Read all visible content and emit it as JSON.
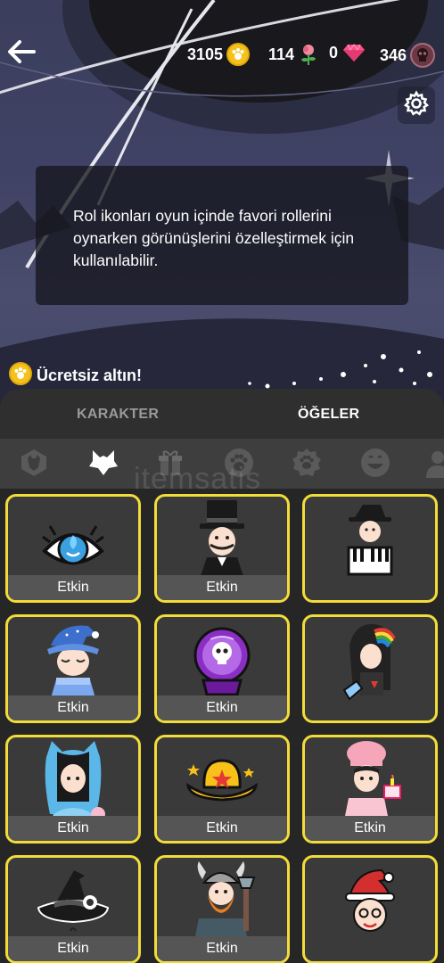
{
  "header": {
    "back_icon": "arrow-left-icon",
    "currencies": [
      {
        "value": "3105",
        "icon": "gold-coin-icon"
      },
      {
        "value": "114",
        "icon": "rose-icon"
      },
      {
        "value": "0",
        "icon": "gem-icon"
      },
      {
        "value": "346",
        "icon": "skull-token-icon"
      }
    ],
    "settings_icon": "gear-icon"
  },
  "info": {
    "text": "Rol ikonları oyun içinde favori rollerini oynarken görünüşlerini özelleştirmek için kullanılabilir."
  },
  "free_gold": {
    "label": "Ücretsiz altın!",
    "icon": "paw-coin-icon"
  },
  "tabs": [
    {
      "label": "KARAKTER",
      "active": false
    },
    {
      "label": "ÖĞELER",
      "active": true
    }
  ],
  "categories": [
    {
      "icon": "wolf-badge-icon",
      "active": false
    },
    {
      "icon": "wolf-head-icon",
      "active": true
    },
    {
      "icon": "gift-icon",
      "active": false
    },
    {
      "icon": "paw-icon",
      "active": false
    },
    {
      "icon": "paw-badge-icon",
      "active": false
    },
    {
      "icon": "smiley-icon",
      "active": false
    },
    {
      "icon": "avatar-icon",
      "active": false
    }
  ],
  "watermark": "itemsatis",
  "items": [
    {
      "icon": "seer-eye-icon",
      "status": "Etkin"
    },
    {
      "icon": "top-hat-gentleman-icon",
      "status": "Etkin"
    },
    {
      "icon": "pianist-icon",
      "status": ""
    },
    {
      "icon": "sleepy-wizard-icon",
      "status": "Etkin"
    },
    {
      "icon": "crystal-ball-skull-icon",
      "status": "Etkin"
    },
    {
      "icon": "rainbow-girl-icon",
      "status": ""
    },
    {
      "icon": "cat-hood-girl-icon",
      "status": "Etkin"
    },
    {
      "icon": "cowboy-hat-icon",
      "status": "Etkin"
    },
    {
      "icon": "baker-chef-icon",
      "status": "Etkin"
    },
    {
      "icon": "witch-hat-icon",
      "status": "Etkin"
    },
    {
      "icon": "viking-warrior-icon",
      "status": "Etkin"
    },
    {
      "icon": "santa-boy-icon",
      "status": ""
    }
  ],
  "colors": {
    "card_border": "#f2dc3a",
    "coin": "#f5c21b",
    "gem": "#ff4f86",
    "panel": "#2f2f2f"
  }
}
